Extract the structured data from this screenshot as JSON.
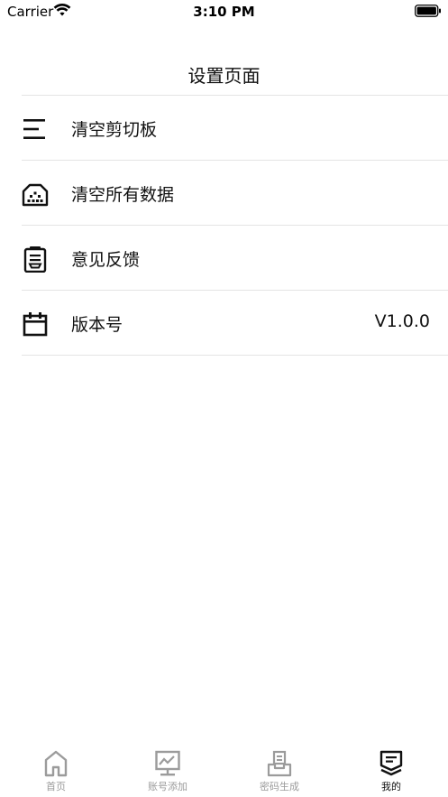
{
  "status_bar": {
    "carrier": "Carrier",
    "time": "3:10 PM",
    "wifi_icon": "wifi-icon",
    "battery_icon": "battery-icon"
  },
  "nav": {
    "title": "设置页面"
  },
  "settings": {
    "items": [
      {
        "label": "清空剪切板",
        "icon": "clear-list-icon"
      },
      {
        "label": "清空所有数据",
        "icon": "clear-data-icon"
      },
      {
        "label": "意见反馈",
        "icon": "feedback-icon"
      },
      {
        "label": "版本号",
        "icon": "calendar-icon",
        "value": "V1.0.0"
      }
    ]
  },
  "tab_bar": {
    "tabs": [
      {
        "label": "首页",
        "icon": "home-icon",
        "active": false
      },
      {
        "label": "账号添加",
        "icon": "chart-board-icon",
        "active": false
      },
      {
        "label": "密码生成",
        "icon": "inbox-icon",
        "active": false
      },
      {
        "label": "我的",
        "icon": "profile-card-icon",
        "active": true
      }
    ]
  },
  "colors": {
    "text": "#111111",
    "divider": "#e4e4e4",
    "tab_inactive": "#9b9b9b",
    "tab_active": "#111111",
    "background": "#ffffff"
  }
}
